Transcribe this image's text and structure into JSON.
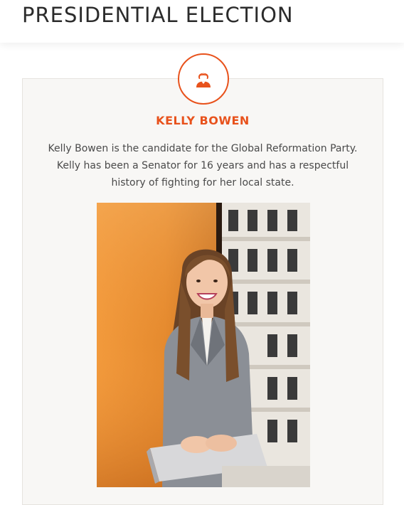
{
  "header": {
    "title": "PRESIDENTIAL ELECTION"
  },
  "candidate": {
    "icon": "person-icon",
    "name": "KELLY BOWEN",
    "bio": "Kelly Bowen is the candidate for the Global Reformation Party. Kelly has been a Senator for 16 years and has a respectful history of fighting for her local state.",
    "photo": "portrait-photo"
  },
  "colors": {
    "accent": "#e8521c",
    "card_background": "#f8f7f5",
    "title_text": "#2b2b2b",
    "body_text": "#4a4a4a"
  }
}
